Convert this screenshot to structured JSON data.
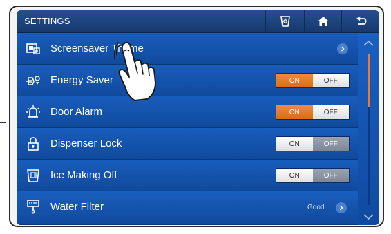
{
  "header": {
    "title": "SETTINGS",
    "icons": [
      "filter-icon",
      "home-icon",
      "back-icon"
    ]
  },
  "rows": [
    {
      "label": "Screensaver Theme",
      "icon": "screensaver-icon",
      "control": "arrow"
    },
    {
      "label": "Energy Saver",
      "icon": "energy-saver-icon",
      "control": "toggle",
      "state": "ON"
    },
    {
      "label": "Door Alarm",
      "icon": "door-alarm-icon",
      "control": "toggle",
      "state": "ON"
    },
    {
      "label": "Dispenser Lock",
      "icon": "dispenser-lock-icon",
      "control": "toggle",
      "state": "OFF"
    },
    {
      "label": "Ice Making Off",
      "icon": "ice-making-icon",
      "control": "toggle",
      "state": "OFF"
    },
    {
      "label": "Water Filter",
      "icon": "water-filter-icon",
      "control": "arrow",
      "status": "Good"
    }
  ],
  "toggle_labels": {
    "on": "ON",
    "off": "OFF"
  },
  "scroll": {
    "position_fraction": 0.0,
    "visible_fraction": 0.35
  },
  "colors": {
    "active_on": "#e9782a",
    "background": "#104a9c",
    "header": "#1e467f"
  }
}
